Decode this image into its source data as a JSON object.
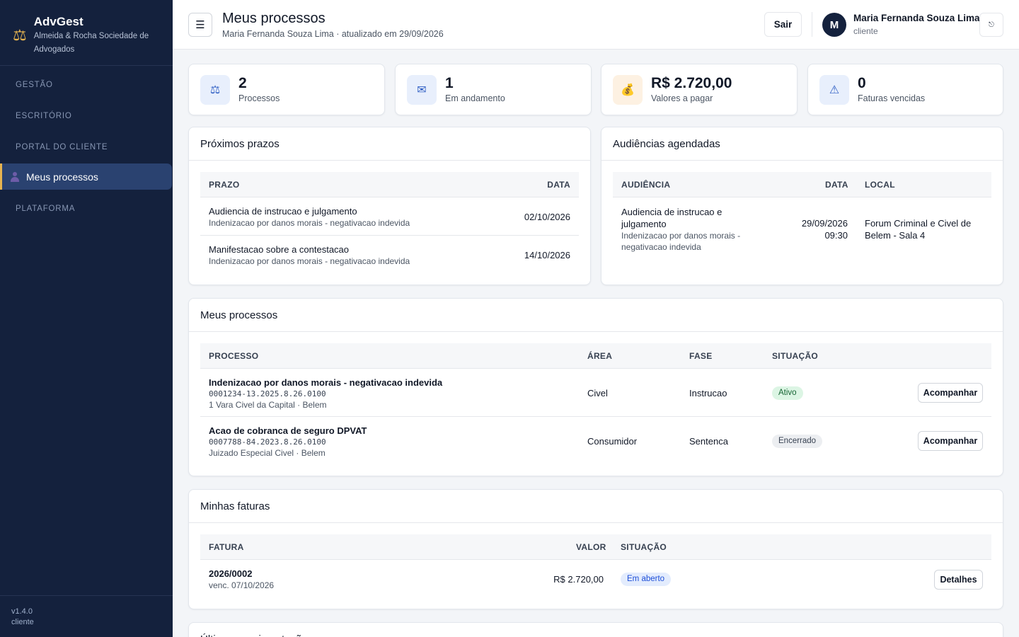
{
  "brand": {
    "name": "AdvGest",
    "subtitle": "Almeida & Rocha Sociedade de Advogados",
    "logo_icon": "scales-icon"
  },
  "sidebar": {
    "sections": [
      {
        "label": "GESTÃO"
      },
      {
        "label": "ESCRITÓRIO"
      },
      {
        "label": "PORTAL DO CLIENTE"
      },
      {
        "label": "PLATAFORMA"
      }
    ],
    "active_item": {
      "label": "Meus processos",
      "icon": "person-icon"
    },
    "version": "v1.4.0",
    "role": "cliente"
  },
  "header": {
    "menu_icon": "☰",
    "title": "Meus processos",
    "subtitle": "Maria Fernanda Souza Lima · atualizado em 29/09/2026",
    "logout_label": "Sair",
    "avatar_initial": "M",
    "user_name": "Maria Fernanda Souza Lima",
    "user_role": "cliente",
    "settings_icon": "⎋"
  },
  "stats": [
    {
      "value": "2",
      "label": "Processos",
      "icon": "⚖",
      "bg": "#e8effc",
      "fg": "#2f5fc4"
    },
    {
      "value": "1",
      "label": "Em andamento",
      "icon": "✉",
      "bg": "#e8effc",
      "fg": "#2f5fc4"
    },
    {
      "value": "R$ 2.720,00",
      "label": "Valores a pagar",
      "icon": "💰",
      "bg": "#fdf1e2",
      "fg": "#b8641a"
    },
    {
      "value": "0",
      "label": "Faturas vencidas",
      "icon": "⚠",
      "bg": "#e8effc",
      "fg": "#2f5fc4"
    }
  ],
  "prazos": {
    "title": "Próximos prazos",
    "columns": [
      "PRAZO",
      "DATA"
    ],
    "rows": [
      {
        "title": "Audiencia de instrucao e julgamento",
        "sub": "Indenizacao por danos morais - negativacao indevida",
        "date": "02/10/2026"
      },
      {
        "title": "Manifestacao sobre a contestacao",
        "sub": "Indenizacao por danos morais - negativacao indevida",
        "date": "14/10/2026"
      }
    ]
  },
  "audiencias": {
    "title": "Audiências agendadas",
    "columns": [
      "AUDIÊNCIA",
      "DATA",
      "LOCAL"
    ],
    "rows": [
      {
        "title_l1": "Audiencia de instrucao e",
        "title_l2": "julgamento",
        "sub_l1": "Indenizacao por danos morais -",
        "sub_l2": "negativacao indevida",
        "date": "29/09/2026",
        "time": "09:30",
        "local_l1": "Forum Criminal e Civel de",
        "local_l2": "Belem - Sala 4"
      }
    ]
  },
  "processos": {
    "title": "Meus processos",
    "columns": [
      "PROCESSO",
      "ÁREA",
      "FASE",
      "SITUAÇÃO"
    ],
    "rows": [
      {
        "title": "Indenizacao por danos morais - negativacao indevida",
        "number": "0001234-13.2025.8.26.0100",
        "court": "1 Vara Civel da Capital · Belem",
        "area": "Civel",
        "fase": "Instrucao",
        "status": "Ativo",
        "status_bg": "#dcf5e4",
        "status_fg": "#166534",
        "action": "Acompanhar"
      },
      {
        "title": "Acao de cobranca de seguro DPVAT",
        "number": "0007788-84.2023.8.26.0100",
        "court": "Juizado Especial Civel · Belem",
        "area": "Consumidor",
        "fase": "Sentenca",
        "status": "Encerrado",
        "status_bg": "#eceef1",
        "status_fg": "#374151",
        "action": "Acompanhar"
      }
    ]
  },
  "faturas": {
    "title": "Minhas faturas",
    "columns": [
      "FATURA",
      "VALOR",
      "SITUAÇÃO"
    ],
    "rows": [
      {
        "id": "2026/0002",
        "due": "venc. 07/10/2026",
        "value": "R$ 2.720,00",
        "status": "Em aberto",
        "status_bg": "#e3ecfd",
        "status_fg": "#1d4ed8",
        "action": "Detalhes"
      }
    ]
  },
  "movimentacoes": {
    "title": "Últimas movimentações"
  }
}
